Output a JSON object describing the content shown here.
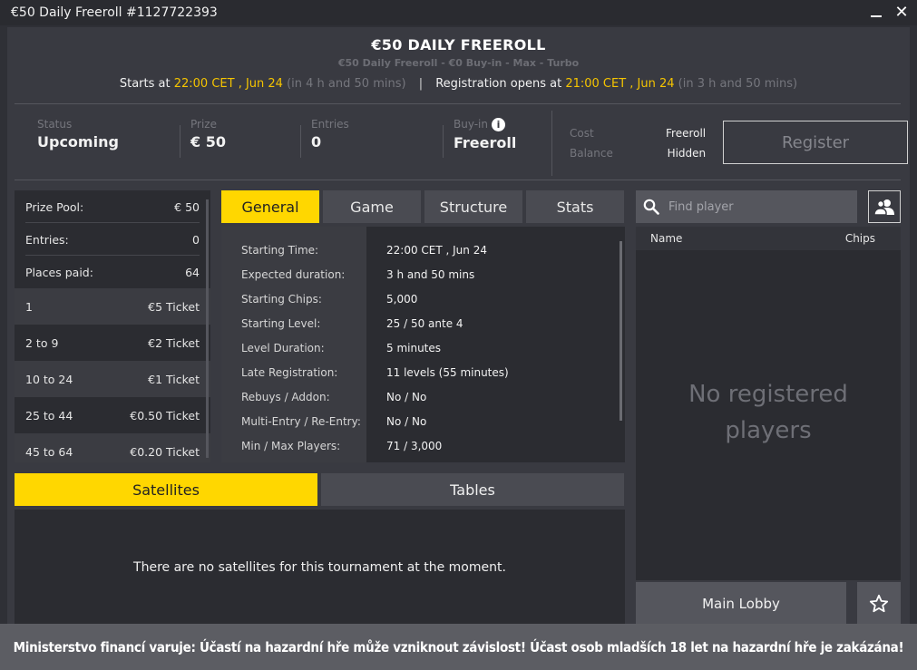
{
  "window": {
    "title": "€50 Daily Freeroll #1127722393"
  },
  "header": {
    "title": "€50 DAILY FREEROLL",
    "subtitle": "€50 Daily Freeroll - €0 Buy-in - Max - Turbo",
    "starts_label": "Starts at",
    "starts_time": "22:00 CET , Jun 24",
    "starts_in": "(in 4 h and 50 mins)",
    "separator": "|",
    "reg_label": "Registration opens at",
    "reg_time": "21:00 CET , Jun 24",
    "reg_in": "(in 3 h and 50 mins)"
  },
  "info": {
    "status_label": "Status",
    "status_value": "Upcoming",
    "prize_label": "Prize",
    "prize_value": "€ 50",
    "entries_label": "Entries",
    "entries_value": "0",
    "buyin_label": "Buy-in",
    "buyin_value": "Freeroll",
    "cost_label": "Cost",
    "balance_label": "Balance",
    "cost_value": "Freeroll",
    "balance_value": "Hidden",
    "register_label": "Register"
  },
  "prize_table": {
    "summary": [
      {
        "label": "Prize Pool:",
        "value": "€ 50"
      },
      {
        "label": "Entries:",
        "value": "0"
      },
      {
        "label": "Places paid:",
        "value": "64"
      }
    ],
    "places": [
      {
        "place": "1",
        "prize": "€5 Ticket"
      },
      {
        "place": "2  to  9",
        "prize": "€2 Ticket"
      },
      {
        "place": "10  to  24",
        "prize": "€1 Ticket"
      },
      {
        "place": "25  to  44",
        "prize": "€0.50 Ticket"
      },
      {
        "place": "45  to  64",
        "prize": "€0.20 Ticket"
      }
    ]
  },
  "tabs": [
    "General",
    "Game",
    "Structure",
    "Stats"
  ],
  "general": [
    {
      "k": "Starting Time:",
      "v": "22:00 CET , Jun 24"
    },
    {
      "k": "Expected duration:",
      "v": "3 h and 50 mins"
    },
    {
      "k": "Starting Chips:",
      "v": "5,000"
    },
    {
      "k": "Starting Level:",
      "v": "25 / 50 ante 4"
    },
    {
      "k": "Level Duration:",
      "v": "5 minutes"
    },
    {
      "k": "Late Registration:",
      "v": "11 levels (55 minutes)"
    },
    {
      "k": "Rebuys / Addon:",
      "v": "No / No"
    },
    {
      "k": "Multi-Entry / Re-Entry:",
      "v": "No / No"
    },
    {
      "k": "Min / Max Players:",
      "v": "71 / 3,000"
    }
  ],
  "players": {
    "search_placeholder": "Find player",
    "col_name": "Name",
    "col_chips": "Chips",
    "empty_line1": "No registered",
    "empty_line2": "players",
    "lobby_label": "Main Lobby"
  },
  "bottom_tabs": [
    "Satellites",
    "Tables"
  ],
  "satellites_msg": "There are no satellites for this tournament at the moment.",
  "warning": "Ministerstvo financí varuje: Účastí na hazardní hře může vzniknout závislost! Účast osob mladších 18 let na hazardní hře je zakázána!",
  "colors": {
    "accent": "#ffd700",
    "bg": "#393a41",
    "panel": "#2b2c31"
  }
}
